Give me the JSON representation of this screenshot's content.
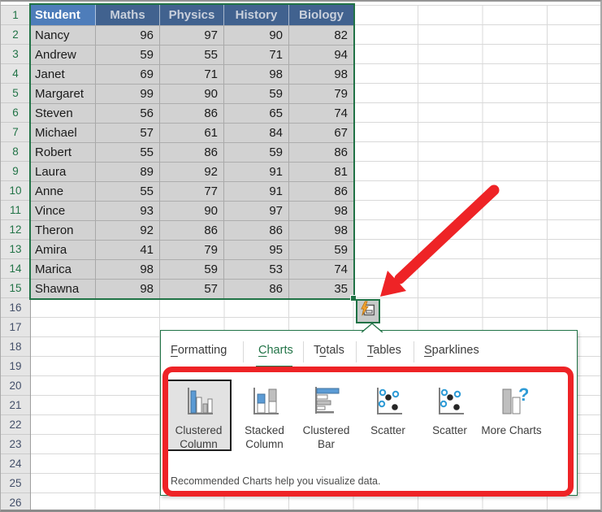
{
  "spreadsheet": {
    "row_headers": {
      "count": 26,
      "selected_through": 15
    },
    "table": {
      "headers": [
        "Student",
        "Maths",
        "Physics",
        "History",
        "Biology"
      ],
      "rows": [
        [
          "Nancy",
          "96",
          "97",
          "90",
          "82"
        ],
        [
          "Andrew",
          "59",
          "55",
          "71",
          "94"
        ],
        [
          "Janet",
          "69",
          "71",
          "98",
          "98"
        ],
        [
          "Margaret",
          "99",
          "90",
          "59",
          "79"
        ],
        [
          "Steven",
          "56",
          "86",
          "65",
          "74"
        ],
        [
          "Michael",
          "57",
          "61",
          "84",
          "67"
        ],
        [
          "Robert",
          "55",
          "86",
          "59",
          "86"
        ],
        [
          "Laura",
          "89",
          "92",
          "91",
          "81"
        ],
        [
          "Anne",
          "55",
          "77",
          "91",
          "86"
        ],
        [
          "Vince",
          "93",
          "90",
          "97",
          "98"
        ],
        [
          "Theron",
          "92",
          "86",
          "86",
          "98"
        ],
        [
          "Amira",
          "41",
          "79",
          "95",
          "59"
        ],
        [
          "Marica",
          "98",
          "59",
          "53",
          "74"
        ],
        [
          "Shawna",
          "98",
          "57",
          "86",
          "35"
        ]
      ]
    }
  },
  "quick_analysis": {
    "button_icon": "quick-analysis-icon",
    "tabs": [
      {
        "label": "Formatting",
        "underline_index": 0,
        "active": false
      },
      {
        "label": "Charts",
        "underline_index": 0,
        "active": true
      },
      {
        "label": "Totals",
        "underline_index": 1,
        "active": false
      },
      {
        "label": "Tables",
        "underline_index": 0,
        "active": false
      },
      {
        "label": "Sparklines",
        "underline_index": 0,
        "active": false
      }
    ],
    "charts": [
      {
        "label": "Clustered Column",
        "icon": "clustered-column-icon",
        "selected": true
      },
      {
        "label": "Stacked Column",
        "icon": "stacked-column-icon",
        "selected": false
      },
      {
        "label": "Clustered Bar",
        "icon": "clustered-bar-icon",
        "selected": false
      },
      {
        "label": "Scatter",
        "icon": "scatter-icon",
        "selected": false
      },
      {
        "label": "Scatter",
        "icon": "scatter-icon",
        "selected": false
      },
      {
        "label": "More Charts",
        "icon": "more-charts-icon",
        "selected": false
      }
    ],
    "footer": "Recommended Charts help you visualize data."
  },
  "colors": {
    "excel_green": "#217346",
    "header_active_bg": "#4e7dba",
    "header_bg": "#41628f",
    "selection_fill": "#d2d2d2",
    "annotation_red": "#ee2326",
    "chart_blue": "#5b9bd5",
    "scatter_blue": "#2e9bd6"
  }
}
